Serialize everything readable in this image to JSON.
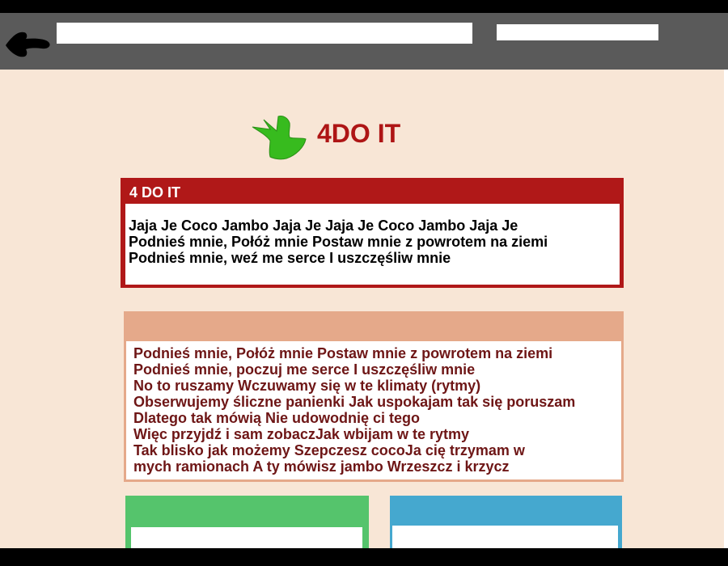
{
  "header": {
    "site_title": "4DO IT"
  },
  "red_box": {
    "title": "4 DO IT",
    "lines": [
      "Jaja Je Coco Jambo Jaja Je Jaja Je Coco Jambo Jaja Je",
      "Podnieś mnie, Połóż mnie Postaw mnie z powrotem na ziemi",
      "Podnieś mnie, weź me serce I uszczęśliw mnie"
    ]
  },
  "salmon_box": {
    "lines": [
      "Podnieś mnie, Połóż mnie Postaw mnie z powrotem na ziemi",
      "Podnieś mnie, poczuj me serce I uszczęśliw mnie",
      "No to ruszamy Wczuwamy się w te klimaty (rytmy)",
      "Obserwujemy śliczne panienki Jak uspokajam tak się poruszam",
      "Dlatego tak mówią Nie udowodnię ci tego",
      "Więc przyjdź i sam zobaczJak wbijam w te rytmy",
      "Tak blisko jak możemy Szepczesz cocoJa cię trzymam w",
      "mych ramionach A ty mówisz jambo Wrzeszcz i krzycz"
    ]
  },
  "colors": {
    "toolbar": "#5a5a5a",
    "page_bg": "#f8e6d6",
    "red": "#b01818",
    "salmon": "#e5a98a",
    "dark_red_text": "#6e1616",
    "green": "#55c46c",
    "blue": "#45a8cf",
    "logo_green": "#37bb1e"
  },
  "icons": {
    "back": "arrow-left-icon",
    "logo": "bird-logo-icon"
  }
}
